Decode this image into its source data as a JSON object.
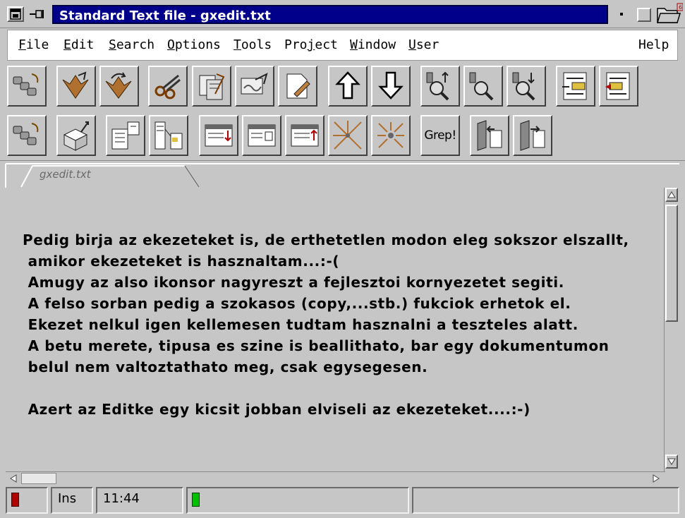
{
  "window": {
    "title": "Standard Text file - gxedit.txt",
    "icons": [
      "window-menu-icon",
      "pin-icon",
      "minimize-icon",
      "maximize-icon",
      "folder-icon"
    ]
  },
  "menu": {
    "items": [
      {
        "label": "File",
        "mnemonic": "F",
        "rest": "ile"
      },
      {
        "label": "Edit",
        "mnemonic": "E",
        "rest": "dit"
      },
      {
        "label": "Search",
        "mnemonic": "S",
        "rest": "earch"
      },
      {
        "label": "Options",
        "mnemonic": "O",
        "rest": "ptions"
      },
      {
        "label": "Tools",
        "mnemonic": "T",
        "rest": "ools"
      },
      {
        "label": "Project",
        "pre": "Pro",
        "mnemonic": "j",
        "rest": "ect"
      },
      {
        "label": "Window",
        "mnemonic": "W",
        "rest": "indow"
      },
      {
        "label": "User",
        "mnemonic": "U",
        "rest": "ser"
      },
      {
        "label": "Help"
      }
    ]
  },
  "toolbar2": {
    "grep_label": "Grep!"
  },
  "tabs": [
    {
      "label": "gxedit.txt",
      "active": true
    }
  ],
  "editor": {
    "lines": [
      "Pedig birja az ekezeteket is, de erthetetlen modon eleg sokszor elszallt,",
      " amikor ekezeteket is hasznaltam...:-(",
      " Amugy az also ikonsor nagyreszt a fejlesztoi kornyezetet segiti.",
      " A felso sorban pedig a szokasos (copy,...stb.) fukciok erhetok el.",
      " Ekezet nelkul igen kellemesen tudtam hasznalni a teszteles alatt.",
      " A betu merete, tipusa es szine is beallithato, bar egy dokumentumon",
      " belul nem valtoztathato meg, csak egysegesen.",
      "",
      " Azert az Editke egy kicsit jobban elviseli az ekezeteket....:-)"
    ]
  },
  "status": {
    "mode": "Ins",
    "time": "11:44",
    "colors": {
      "led_red": "#b00000",
      "led_green": "#00c000"
    }
  },
  "colors": {
    "title_bg": "#00008b",
    "face": "#c6c6c6",
    "menubar_bg": "#ffffff"
  }
}
